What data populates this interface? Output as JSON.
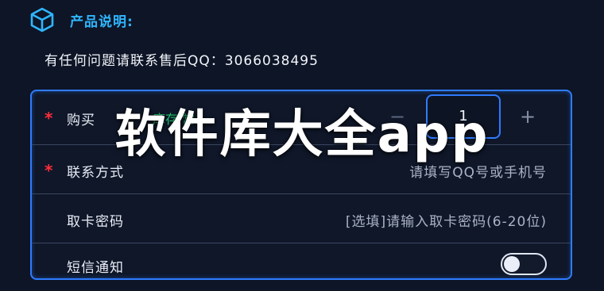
{
  "header": {
    "icon": "cube-icon",
    "title": "产品说明:"
  },
  "support_text": "有任何问题请联系售后QQ：3066038495",
  "form": {
    "quantity": {
      "required_mark": "*",
      "label": "购买",
      "stock_text": "库存 常",
      "minus": "−",
      "value": "1",
      "plus": "+"
    },
    "contact": {
      "required_mark": "*",
      "label": "联系方式",
      "placeholder": "请填写QQ号或手机号"
    },
    "pickup_code": {
      "label": "取卡密码",
      "placeholder": "[选填]请输入取卡密码(6-20位)"
    },
    "fourth_row": {
      "label": "短信通知"
    }
  },
  "watermark": "软件库大全app",
  "colors": {
    "accent": "#2f7bff",
    "title": "#2fb6ff",
    "required": "#ff2d3a",
    "stock": "#22c36a"
  }
}
